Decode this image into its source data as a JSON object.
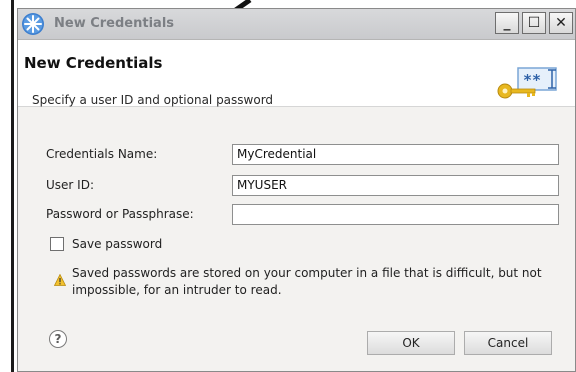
{
  "window": {
    "title": "New Credentials",
    "minimize": "_",
    "maximize": "☐",
    "close": "✕"
  },
  "header": {
    "title": "New Credentials",
    "description": "Specify a user ID and optional password",
    "graphic_text": "**"
  },
  "form": {
    "credentials_name": {
      "label": "Credentials Name:",
      "value": "MyCredential"
    },
    "user_id": {
      "label": "User ID:",
      "value": "MYUSER"
    },
    "password": {
      "label": "Password or Passphrase:",
      "value": ""
    }
  },
  "save_password": {
    "label": "Save password",
    "checked": false
  },
  "warning": {
    "text": "Saved passwords are stored on your computer in a file that is difficult, but not impossible, for an intruder to read."
  },
  "help": {
    "glyph": "?"
  },
  "buttons": {
    "ok": "OK",
    "cancel": "Cancel"
  },
  "colors": {
    "titlebar": "#cfd0d3",
    "title_text": "#7c7f84",
    "dialog_bg": "#f3f2f0",
    "header_bg": "#ffffff",
    "key_gold": "#e8b820",
    "warning_yellow": "#f2c12e"
  }
}
